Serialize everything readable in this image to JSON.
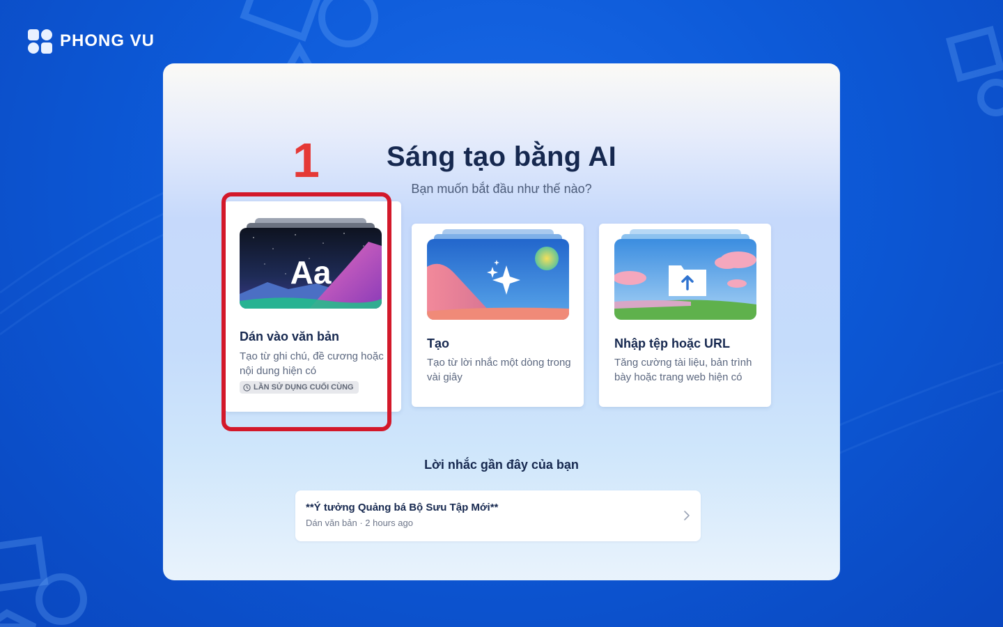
{
  "brand": {
    "name": "PHONG VU"
  },
  "page": {
    "title": "Sáng tạo bằng AI",
    "subtitle": "Bạn muốn bắt đầu như thế nào?",
    "step_number": "1"
  },
  "cards": [
    {
      "title": "Dán vào văn bản",
      "description": "Tạo từ ghi chú, đề cương hoặc nội dung hiện có",
      "badge": "LẦN SỬ DỤNG CUỐI CÙNG",
      "thumb_text": "Aa",
      "highlighted": true
    },
    {
      "title": "Tạo",
      "description": "Tạo từ lời nhắc một dòng trong vài giây"
    },
    {
      "title": "Nhập tệp hoặc URL",
      "description": "Tăng cường tài liệu, bản trình bày hoặc trang web hiện có"
    }
  ],
  "recent": {
    "heading": "Lời nhắc gần đây của bạn",
    "items": [
      {
        "title": "**Ý tưởng Quảng bá Bộ Sưu Tập Mới**",
        "meta": "Dán văn bản · 2 hours ago"
      }
    ]
  },
  "colors": {
    "highlight": "#d3182a",
    "step_number": "#e53936",
    "heading": "#16284f",
    "background": "#0d5ad8"
  },
  "icons": [
    "clock-icon",
    "sparkle-icon",
    "folder-upload-icon",
    "chevron-right-icon"
  ]
}
